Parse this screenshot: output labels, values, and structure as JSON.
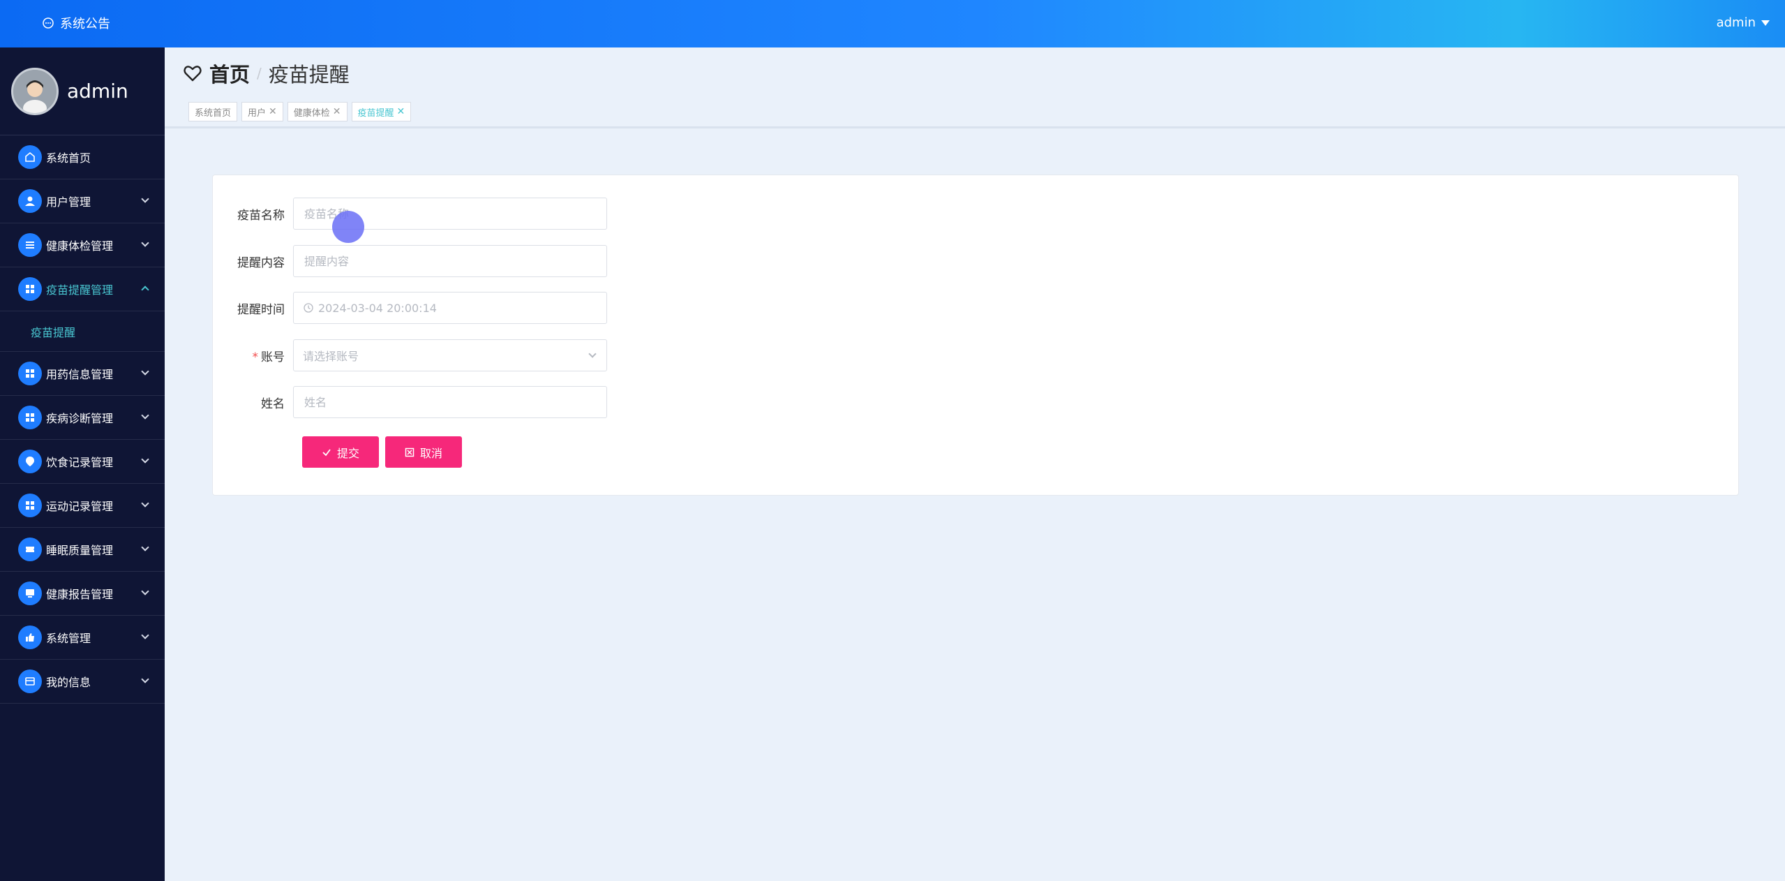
{
  "topbar": {
    "notice_label": "系统公告",
    "user_label": "admin",
    "icons": {
      "notice": "chat-bubble-icon",
      "user_menu": "caret-down-icon"
    }
  },
  "sidebar": {
    "profile_name": "admin",
    "items": [
      {
        "label": "系统首页",
        "icon": "home-icon",
        "expandable": false
      },
      {
        "label": "用户管理",
        "icon": "user-icon",
        "expandable": true
      },
      {
        "label": "健康体检管理",
        "icon": "list-icon",
        "expandable": true
      },
      {
        "label": "疫苗提醒管理",
        "icon": "grid-icon",
        "expandable": true,
        "expanded": true,
        "active": true
      },
      {
        "label": "用药信息管理",
        "icon": "grid-icon",
        "expandable": true
      },
      {
        "label": "疾病诊断管理",
        "icon": "grid-icon",
        "expandable": true
      },
      {
        "label": "饮食记录管理",
        "icon": "location-pin-icon",
        "expandable": true
      },
      {
        "label": "运动记录管理",
        "icon": "grid-icon",
        "expandable": true
      },
      {
        "label": "睡眠质量管理",
        "icon": "ticket-icon",
        "expandable": true
      },
      {
        "label": "健康报告管理",
        "icon": "monitor-icon",
        "expandable": true
      },
      {
        "label": "系统管理",
        "icon": "thumb-icon",
        "expandable": true
      },
      {
        "label": "我的信息",
        "icon": "card-icon",
        "expandable": true
      }
    ],
    "submenu": {
      "label": "疫苗提醒"
    }
  },
  "breadcrumb": {
    "home": "首页",
    "separator": "/",
    "current": "疫苗提醒"
  },
  "tags": [
    {
      "label": "系统首页",
      "closable": false,
      "active": false
    },
    {
      "label": "用户",
      "closable": true,
      "active": false
    },
    {
      "label": "健康体检",
      "closable": true,
      "active": false
    },
    {
      "label": "疫苗提醒",
      "closable": true,
      "active": true
    }
  ],
  "form": {
    "vaccine_name": {
      "label": "疫苗名称",
      "placeholder": "疫苗名称",
      "value": ""
    },
    "reminder_content": {
      "label": "提醒内容",
      "placeholder": "提醒内容",
      "value": ""
    },
    "reminder_time": {
      "label": "提醒时间",
      "value": "2024-03-04 20:00:14"
    },
    "account": {
      "label": "账号",
      "required": true,
      "placeholder": "请选择账号"
    },
    "name": {
      "label": "姓名",
      "placeholder": "姓名",
      "value": ""
    },
    "submit_label": "提交",
    "cancel_label": "取消"
  },
  "colors": {
    "accent": "#1f7dff",
    "active_teal": "#49c6d1",
    "button_pink": "#f6287a",
    "sidebar_bg": "#0f1535"
  }
}
